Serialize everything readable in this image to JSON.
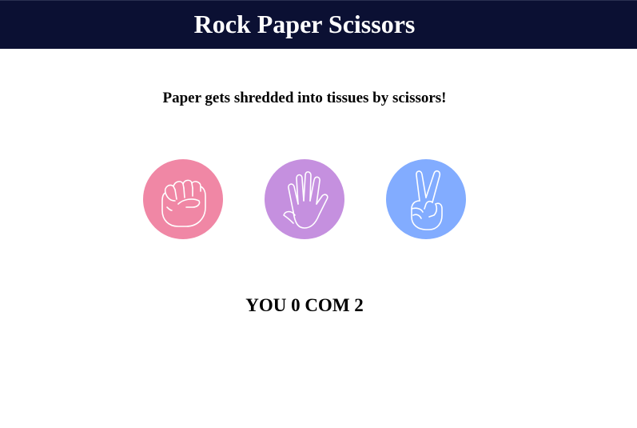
{
  "header": {
    "title": "Rock Paper Scissors",
    "background": "#0b1033"
  },
  "result_message": "Paper gets shredded into tissues by scissors!",
  "choices": [
    {
      "id": "rock",
      "icon": "fist-icon",
      "color": "#f087a5"
    },
    {
      "id": "paper",
      "icon": "open-hand-icon",
      "color": "#c590df"
    },
    {
      "id": "scissors",
      "icon": "peace-sign-icon",
      "color": "#82acff"
    }
  ],
  "score": {
    "text": "YOU 0 COM 2",
    "you": 0,
    "com": 2
  }
}
